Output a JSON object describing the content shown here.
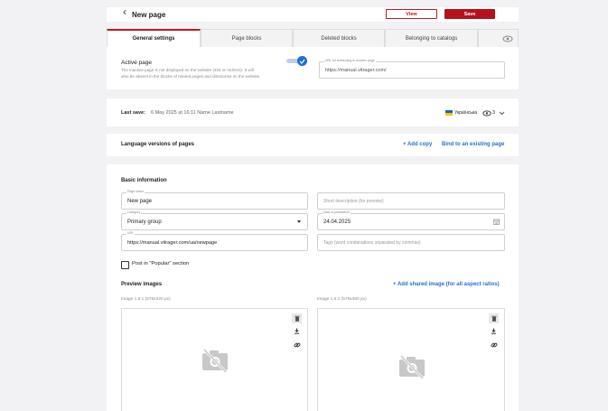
{
  "header": {
    "back_glyph": "‹",
    "title": "New page",
    "view_label": "View",
    "save_label": "Save"
  },
  "tabs": [
    {
      "label": "General settings",
      "active": true
    },
    {
      "label": "Page blocks"
    },
    {
      "label": "Deleted blocks"
    },
    {
      "label": "Belonging to catalogs"
    }
  ],
  "active_page": {
    "title": "Active page",
    "description_line1": "The inactive page is not displayed on the website (404 or redirect). It will",
    "description_line2": "also be absent in the blocks of related pages and directories on the website",
    "toggle_on": true,
    "redirect_label": "URL for redirecting to another page",
    "redirect_value": "https://manual.vitrager.com/"
  },
  "last_save": {
    "label": "Last save:",
    "value": "6 May 2025 at 16:11  Name Lastname",
    "language": "Українська",
    "views": "3"
  },
  "language_versions": {
    "title": "Language versions of pages",
    "add_copy": "+ Add copy",
    "bind": "Bind to an existing page"
  },
  "basic": {
    "title": "Basic information",
    "page_name_label": "Page name",
    "page_name_value": "New page",
    "short_desc_placeholder": "Short description (for preview)",
    "category_label": "Category",
    "category_value": "Primary group",
    "date_label": "Date of publication",
    "date_value": "24.04.2025",
    "url_label": "URL",
    "url_value": "https://manual.vitrager.com/ua/newpage",
    "tags_placeholder": "Tags (word combinations separated by commas)",
    "popular_label": "Post in \"Popular\" section"
  },
  "preview": {
    "title": "Preview images",
    "add_shared": "+ Add shared image (for all aspect ratios)",
    "image1_label": "Image 1.8:1 (576x320 px)",
    "image2_label": "Image 1.6:1 (576x360 px)"
  },
  "colors": {
    "accent": "#c4161c",
    "link": "#2a6fcf",
    "toggle": "#1f6fd6"
  }
}
